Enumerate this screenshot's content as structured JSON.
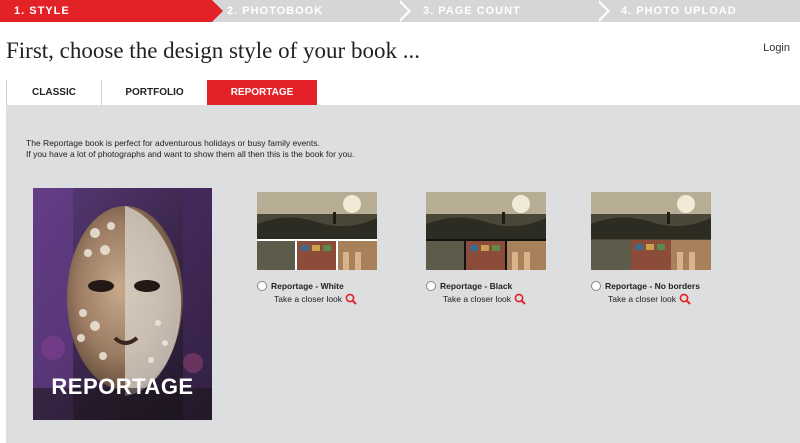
{
  "steps": [
    {
      "label": "1. STYLE",
      "active": true
    },
    {
      "label": "2. PHOTOBOOK",
      "active": false
    },
    {
      "label": "3. PAGE COUNT",
      "active": false
    },
    {
      "label": "4. PHOTO UPLOAD",
      "active": false
    }
  ],
  "page_title": "First, choose the design style of your book ...",
  "login_label": "Login",
  "tabs": [
    {
      "label": "CLASSIC",
      "active": false
    },
    {
      "label": "PORTFOLIO",
      "active": false
    },
    {
      "label": "REPORTAGE",
      "active": true
    }
  ],
  "description": {
    "line1": "The Reportage book is perfect for adventurous holidays or busy family events.",
    "line2": "If you have a lot of photographs and want to show them all then this is the book for you."
  },
  "cover_title": "REPORTAGE",
  "options": [
    {
      "label": "Reportage - White",
      "closer": "Take a closer look",
      "frame_color": "#ffffff"
    },
    {
      "label": "Reportage - Black",
      "closer": "Take a closer look",
      "frame_color": "#111111"
    },
    {
      "label": "Reportage - No borders",
      "closer": "Take a closer look",
      "frame_color": "none"
    }
  ],
  "colors": {
    "accent": "#e32227",
    "steps_bg": "#d4d6d8",
    "panel_bg": "#dcdee0"
  },
  "icons": {
    "magnifier": "magnifier-icon"
  }
}
